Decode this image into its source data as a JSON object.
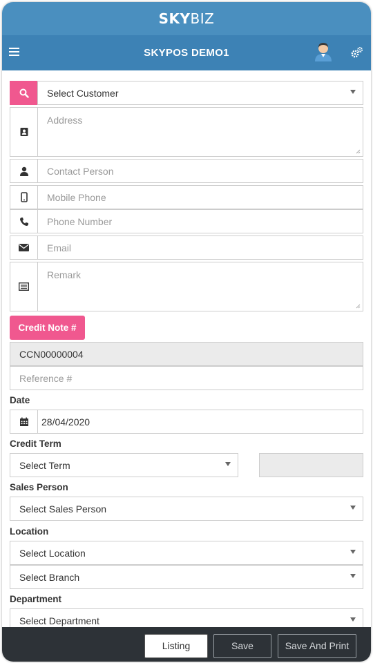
{
  "brand": {
    "prefix": "SKY",
    "suffix": "BIZ"
  },
  "nav": {
    "title": "SKYPOS DEMO1"
  },
  "customer": {
    "select": "Select Customer",
    "address_placeholder": "Address",
    "contact_placeholder": "Contact Person",
    "mobile_placeholder": "Mobile Phone",
    "phone_placeholder": "Phone Number",
    "email_placeholder": "Email",
    "remark_placeholder": "Remark"
  },
  "credit_note": {
    "button_label": "Credit Note #",
    "number": "CCN00000004",
    "reference_placeholder": "Reference #"
  },
  "date": {
    "label": "Date",
    "value": "28/04/2020"
  },
  "credit_term": {
    "label": "Credit Term",
    "select": "Select Term",
    "value": ""
  },
  "sales_person": {
    "label": "Sales Person",
    "select": "Select Sales Person"
  },
  "location": {
    "label": "Location",
    "select": "Select Location",
    "branch_select": "Select Branch"
  },
  "department": {
    "label": "Department",
    "select": "Select Department"
  },
  "footer": {
    "listing": "Listing",
    "save": "Save",
    "save_print": "Save And Print"
  },
  "colors": {
    "brand_bar": "#4a8fbf",
    "nav_bar": "#3d82b5",
    "accent_pink": "#f0588f",
    "footer": "#2d3237"
  }
}
